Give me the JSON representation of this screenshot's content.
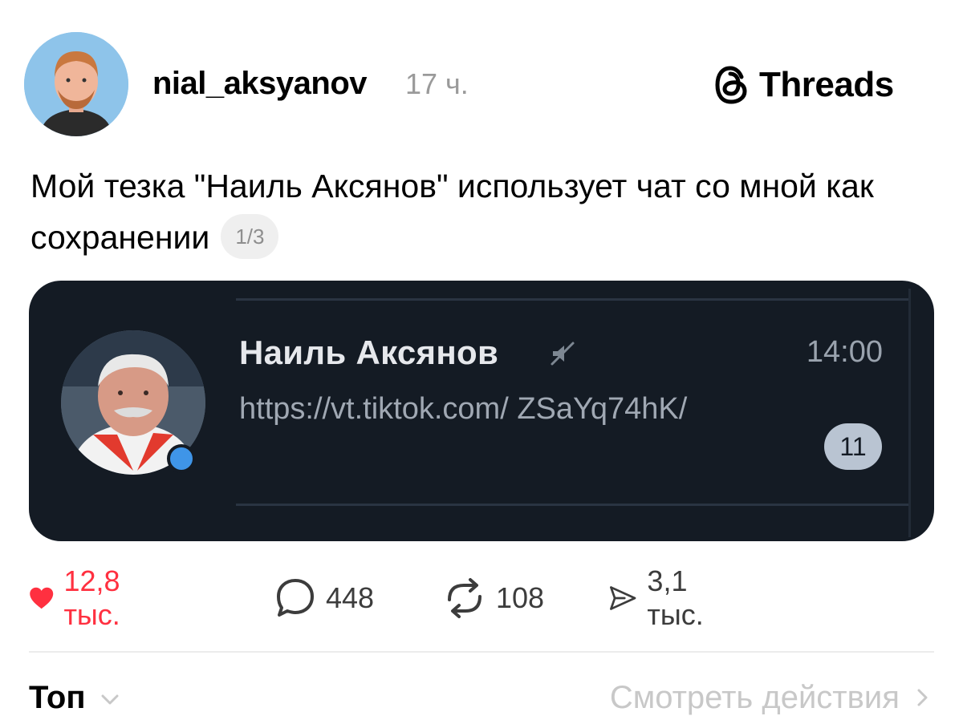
{
  "post": {
    "username": "nial_aksyanov",
    "time": "17 ч.",
    "platform": "Threads",
    "text": "Мой тезка \"Наиль Аксянов\" использует чат со мной как сохранении",
    "page_indicator": "1/3"
  },
  "chat_preview": {
    "contact_name": "Наиль Аксянов",
    "time": "14:00",
    "message": "https://vt.tiktok.com/ ZSaYq74hK/",
    "unread_count": "11"
  },
  "actions": {
    "likes": "12,8 тыс.",
    "comments": "448",
    "reposts": "108",
    "shares": "3,1 тыс."
  },
  "footer": {
    "sort_label": "Топ",
    "activity_link": "Смотреть действия"
  },
  "colors": {
    "like": "#ff3040",
    "card_bg": "#141b24",
    "online_dot": "#3f95e8"
  },
  "icons": [
    "threads-logo-icon",
    "heart-icon",
    "comment-icon",
    "repost-icon",
    "share-icon",
    "mute-icon",
    "chevron-down-icon",
    "chevron-right-icon"
  ]
}
